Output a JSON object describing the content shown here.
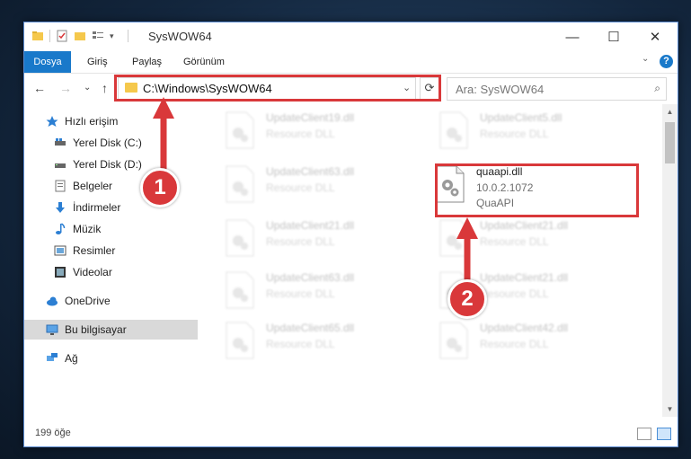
{
  "window": {
    "title": "SysWOW64",
    "minimize": "—",
    "maximize": "☐",
    "close": "✕"
  },
  "ribbon": {
    "tabs": [
      "Dosya",
      "Giriş",
      "Paylaş",
      "Görünüm"
    ],
    "help": "?"
  },
  "nav": {
    "back": "←",
    "forward": "→",
    "recent": "⌄",
    "up": "↑",
    "address": "C:\\Windows\\SysWOW64",
    "address_dropdown": "⌄",
    "refresh": "⟳",
    "search_placeholder": "Ara: SysWOW64",
    "search_icon": "⌕"
  },
  "sidebar": {
    "items": [
      {
        "label": "Hızlı erişim",
        "icon": "star-icon"
      },
      {
        "label": "Yerel Disk (C:)",
        "icon": "drive-icon",
        "pinned": true
      },
      {
        "label": "Yerel Disk (D:)",
        "icon": "drive-icon",
        "pinned": true
      },
      {
        "label": "Belgeler",
        "icon": "documents-icon",
        "pinned": true
      },
      {
        "label": "İndirmeler",
        "icon": "downloads-icon",
        "pinned": true
      },
      {
        "label": "Müzik",
        "icon": "music-icon",
        "pinned": true
      },
      {
        "label": "Resimler",
        "icon": "pictures-icon",
        "pinned": true
      },
      {
        "label": "Videolar",
        "icon": "videos-icon",
        "pinned": true
      },
      {
        "label": "OneDrive",
        "icon": "cloud-icon"
      },
      {
        "label": "Bu bilgisayar",
        "icon": "computer-icon",
        "selected": true
      },
      {
        "label": "Ağ",
        "icon": "network-icon"
      }
    ]
  },
  "files": [
    {
      "name": "UpdateClient19.dll",
      "line2": "Resource DLL",
      "line3": "",
      "faded": true
    },
    {
      "name": "UpdateClient5.dll",
      "line2": "Resource DLL",
      "line3": "",
      "faded": true
    },
    {
      "name": "UpdateClient63.dll",
      "line2": "Resource DLL",
      "line3": "",
      "faded": true
    },
    {
      "name": "quaapi.dll",
      "line2": "10.0.2.1072",
      "line3": "QuaAPI",
      "faded": false
    },
    {
      "name": "UpdateClient21.dll",
      "line2": "Resource DLL",
      "line3": "",
      "faded": true
    },
    {
      "name": "UpdateClient21.dll",
      "line2": "Resource DLL",
      "line3": "",
      "faded": true
    },
    {
      "name": "UpdateClient63.dll",
      "line2": "Resource DLL",
      "line3": "",
      "faded": true
    },
    {
      "name": "UpdateClient21.dll",
      "line2": "Resource DLL",
      "line3": "",
      "faded": true
    },
    {
      "name": "UpdateClient65.dll",
      "line2": "Resource DLL",
      "line3": "",
      "faded": true
    },
    {
      "name": "UpdateClient42.dll",
      "line2": "Resource DLL",
      "line3": "",
      "faded": true
    }
  ],
  "status": {
    "item_count": "199 öğe"
  },
  "callouts": {
    "step1": "1",
    "step2": "2",
    "color": "#d9383a"
  }
}
